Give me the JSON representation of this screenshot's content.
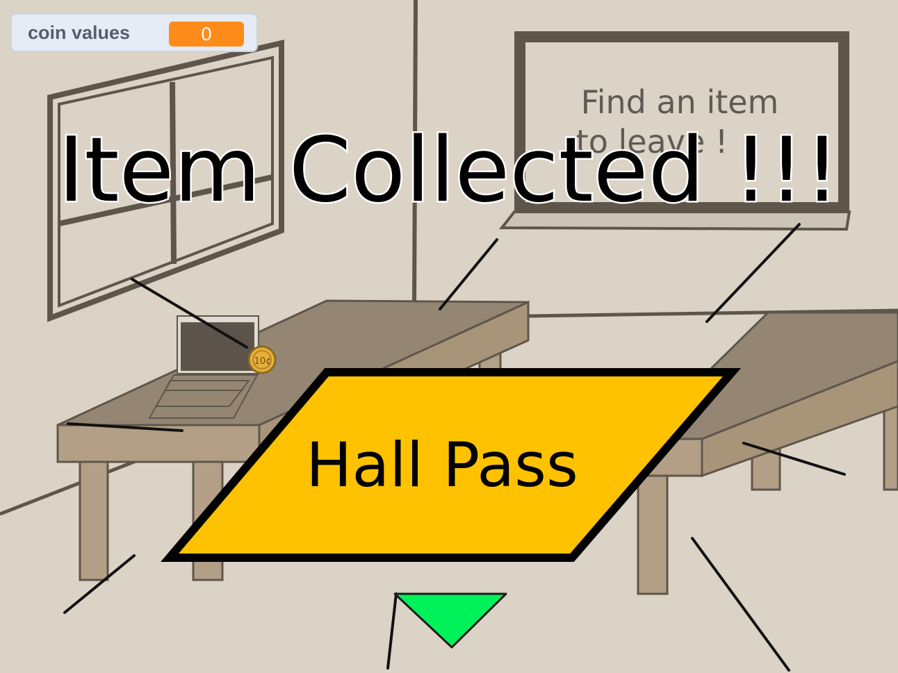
{
  "hud": {
    "monitor_label": "coin values",
    "monitor_value": "0"
  },
  "scene": {
    "board_text_line1": "Find an item",
    "board_text_line2": "to leave !",
    "coin_label": "10¢"
  },
  "overlay": {
    "message": "Item Collected !!!",
    "item_name": "Hall Pass"
  },
  "colors": {
    "background": "#dbd3c6",
    "wall_line": "#5f564b",
    "desk_top": "#948673",
    "desk_front": "#b29f85",
    "hall_pass": "#ffc200",
    "arrow": "#00f25a",
    "monitor_value_bg": "#ff8c1a"
  },
  "icons": {
    "navigation_arrow": "green-down-triangle",
    "laptop": "laptop",
    "coin": "coin"
  }
}
